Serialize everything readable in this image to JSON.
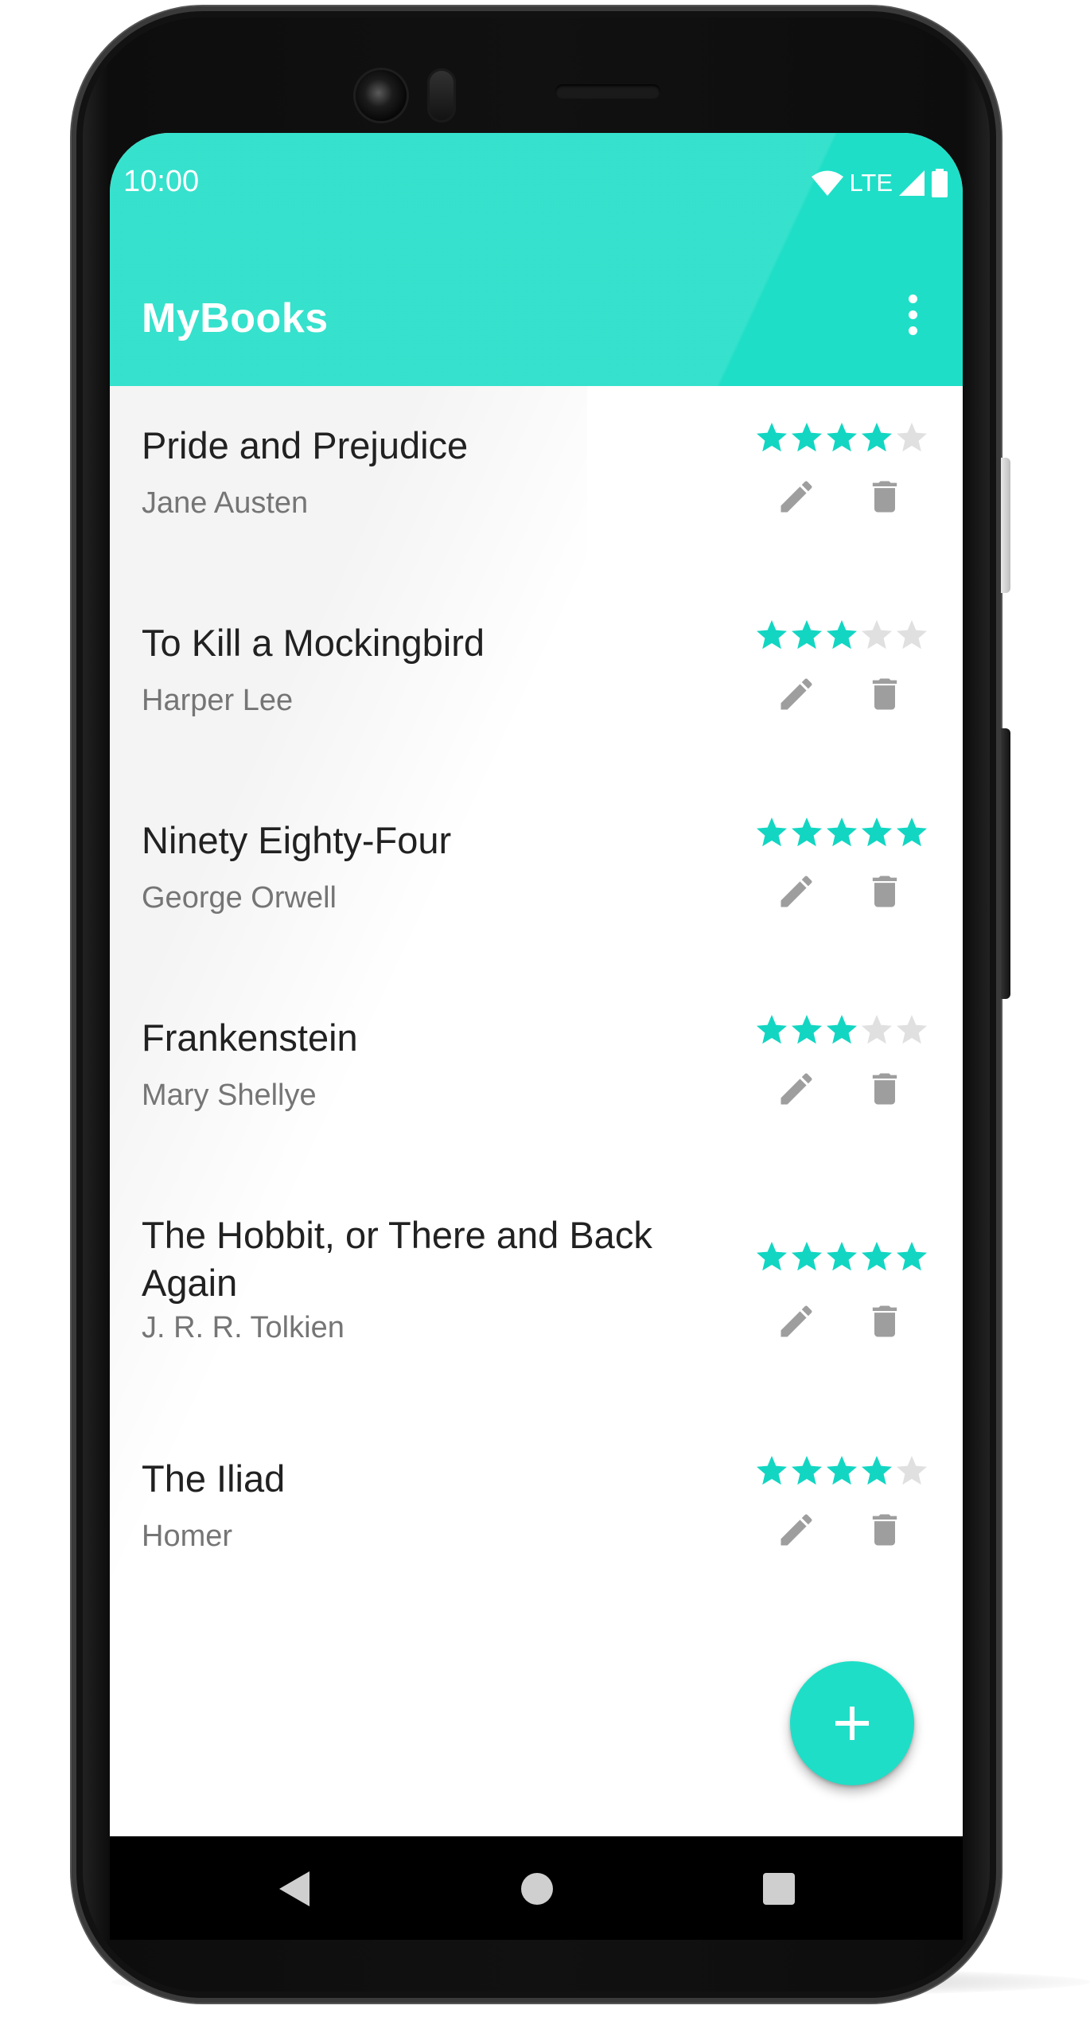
{
  "status_bar": {
    "time": "10:00",
    "network": "LTE",
    "icons": [
      "wifi-icon",
      "cell-signal-icon",
      "battery-icon"
    ]
  },
  "app_bar": {
    "title": "MyBooks",
    "menu_icon": "more-vert-icon"
  },
  "books": [
    {
      "title": "Pride and Prejudice",
      "author": "Jane Austen",
      "rating": 4
    },
    {
      "title": "To Kill a Mockingbird",
      "author": "Harper Lee",
      "rating": 3
    },
    {
      "title": "Ninety Eighty-Four",
      "author": "George Orwell",
      "rating": 5
    },
    {
      "title": "Frankenstein",
      "author": "Mary Shellye",
      "rating": 3
    },
    {
      "title": "The Hobbit, or There and Back Again",
      "author": "J. R. R. Tolkien",
      "rating": 5
    },
    {
      "title": "The Iliad",
      "author": "Homer",
      "rating": 4
    }
  ],
  "rating_max": 5,
  "actions": {
    "edit_icon": "pencil-icon",
    "delete_icon": "trash-icon"
  },
  "fab": {
    "icon": "plus-icon"
  },
  "nav_bar": {
    "back_icon": "back-triangle-icon",
    "home_icon": "home-circle-icon",
    "recents_icon": "recents-square-icon"
  },
  "colors": {
    "accent": "#1fdec7",
    "star_filled": "#12d6c2",
    "star_empty": "#e0e0e0",
    "icon_gray": "#9e9e9e",
    "title_text": "#212121",
    "subtitle_text": "#757575"
  }
}
